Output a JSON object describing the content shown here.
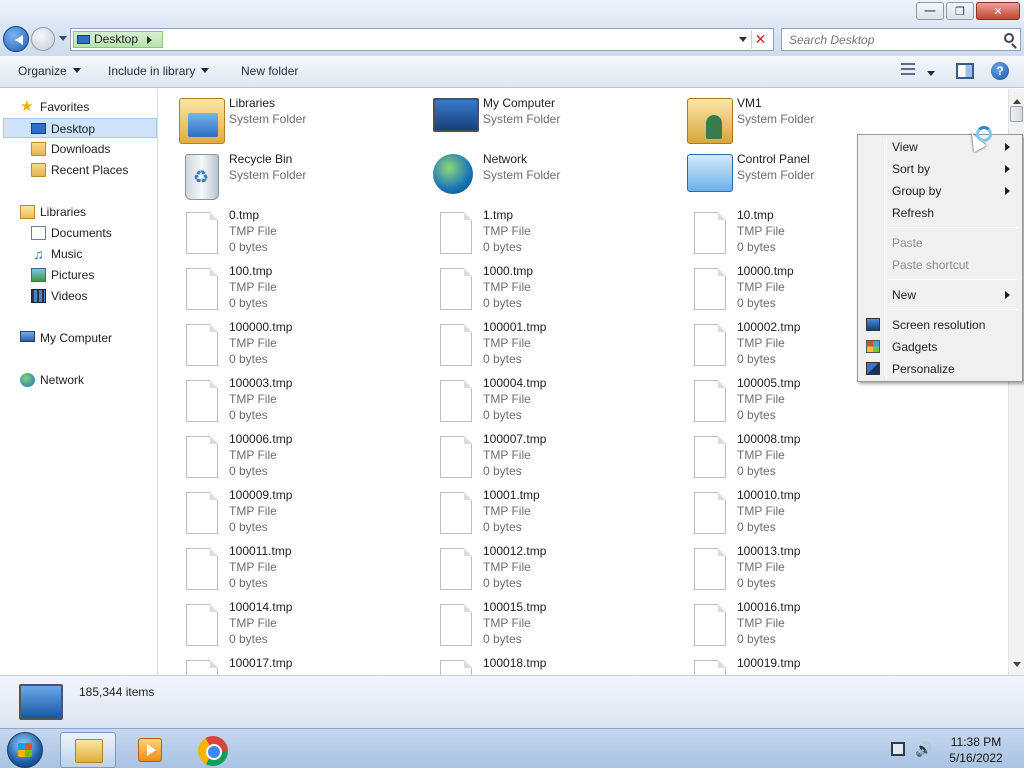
{
  "window": {
    "controls": {
      "minimize": "—",
      "maximize": "❐",
      "close": "✕"
    }
  },
  "address_bar": {
    "crumb": "Desktop",
    "search_placeholder": "Search Desktop"
  },
  "toolbar": {
    "organize": "Organize",
    "include_in_library": "Include in library",
    "new_folder": "New folder",
    "help": "?"
  },
  "nav_pane": {
    "favorites": "Favorites",
    "desktop": "Desktop",
    "downloads": "Downloads",
    "recent_places": "Recent Places",
    "libraries": "Libraries",
    "documents": "Documents",
    "music": "Music",
    "pictures": "Pictures",
    "videos": "Videos",
    "my_computer": "My Computer",
    "network": "Network"
  },
  "content": {
    "special_items": [
      {
        "name": "Libraries",
        "type": "System Folder",
        "icon": "libraries-icon"
      },
      {
        "name": "My Computer",
        "type": "System Folder",
        "icon": "my-computer-icon"
      },
      {
        "name": "VM1",
        "type": "System Folder",
        "icon": "user-folder-icon"
      },
      {
        "name": "Recycle Bin",
        "type": "System Folder",
        "icon": "recycle-bin-icon"
      },
      {
        "name": "Network",
        "type": "System Folder",
        "icon": "network-icon"
      },
      {
        "name": "Control Panel",
        "type": "System Folder",
        "icon": "control-panel-icon"
      }
    ],
    "files": [
      {
        "name": "0.tmp",
        "type": "TMP File",
        "size": "0 bytes"
      },
      {
        "name": "1.tmp",
        "type": "TMP File",
        "size": "0 bytes"
      },
      {
        "name": "10.tmp",
        "type": "TMP File",
        "size": "0 bytes"
      },
      {
        "name": "100.tmp",
        "type": "TMP File",
        "size": "0 bytes"
      },
      {
        "name": "1000.tmp",
        "type": "TMP File",
        "size": "0 bytes"
      },
      {
        "name": "10000.tmp",
        "type": "TMP File",
        "size": "0 bytes"
      },
      {
        "name": "100000.tmp",
        "type": "TMP File",
        "size": "0 bytes"
      },
      {
        "name": "100001.tmp",
        "type": "TMP File",
        "size": "0 bytes"
      },
      {
        "name": "100002.tmp",
        "type": "TMP File",
        "size": "0 bytes"
      },
      {
        "name": "100003.tmp",
        "type": "TMP File",
        "size": "0 bytes"
      },
      {
        "name": "100004.tmp",
        "type": "TMP File",
        "size": "0 bytes"
      },
      {
        "name": "100005.tmp",
        "type": "TMP File",
        "size": "0 bytes"
      },
      {
        "name": "100006.tmp",
        "type": "TMP File",
        "size": "0 bytes"
      },
      {
        "name": "100007.tmp",
        "type": "TMP File",
        "size": "0 bytes"
      },
      {
        "name": "100008.tmp",
        "type": "TMP File",
        "size": "0 bytes"
      },
      {
        "name": "100009.tmp",
        "type": "TMP File",
        "size": "0 bytes"
      },
      {
        "name": "10001.tmp",
        "type": "TMP File",
        "size": "0 bytes"
      },
      {
        "name": "100010.tmp",
        "type": "TMP File",
        "size": "0 bytes"
      },
      {
        "name": "100011.tmp",
        "type": "TMP File",
        "size": "0 bytes"
      },
      {
        "name": "100012.tmp",
        "type": "TMP File",
        "size": "0 bytes"
      },
      {
        "name": "100013.tmp",
        "type": "TMP File",
        "size": "0 bytes"
      },
      {
        "name": "100014.tmp",
        "type": "TMP File",
        "size": "0 bytes"
      },
      {
        "name": "100015.tmp",
        "type": "TMP File",
        "size": "0 bytes"
      },
      {
        "name": "100016.tmp",
        "type": "TMP File",
        "size": "0 bytes"
      },
      {
        "name": "100017.tmp",
        "type": "",
        "size": ""
      },
      {
        "name": "100018.tmp",
        "type": "",
        "size": ""
      },
      {
        "name": "100019.tmp",
        "type": "",
        "size": ""
      }
    ]
  },
  "context_menu": {
    "view": "View",
    "sort_by": "Sort by",
    "group_by": "Group by",
    "refresh": "Refresh",
    "paste": "Paste",
    "paste_shortcut": "Paste shortcut",
    "new": "New",
    "screen_resolution": "Screen resolution",
    "gadgets": "Gadgets",
    "personalize": "Personalize"
  },
  "details_pane": {
    "item_count": "185,344 items"
  },
  "taskbar": {
    "clock_time": "11:38 PM",
    "clock_date": "5/16/2022"
  }
}
